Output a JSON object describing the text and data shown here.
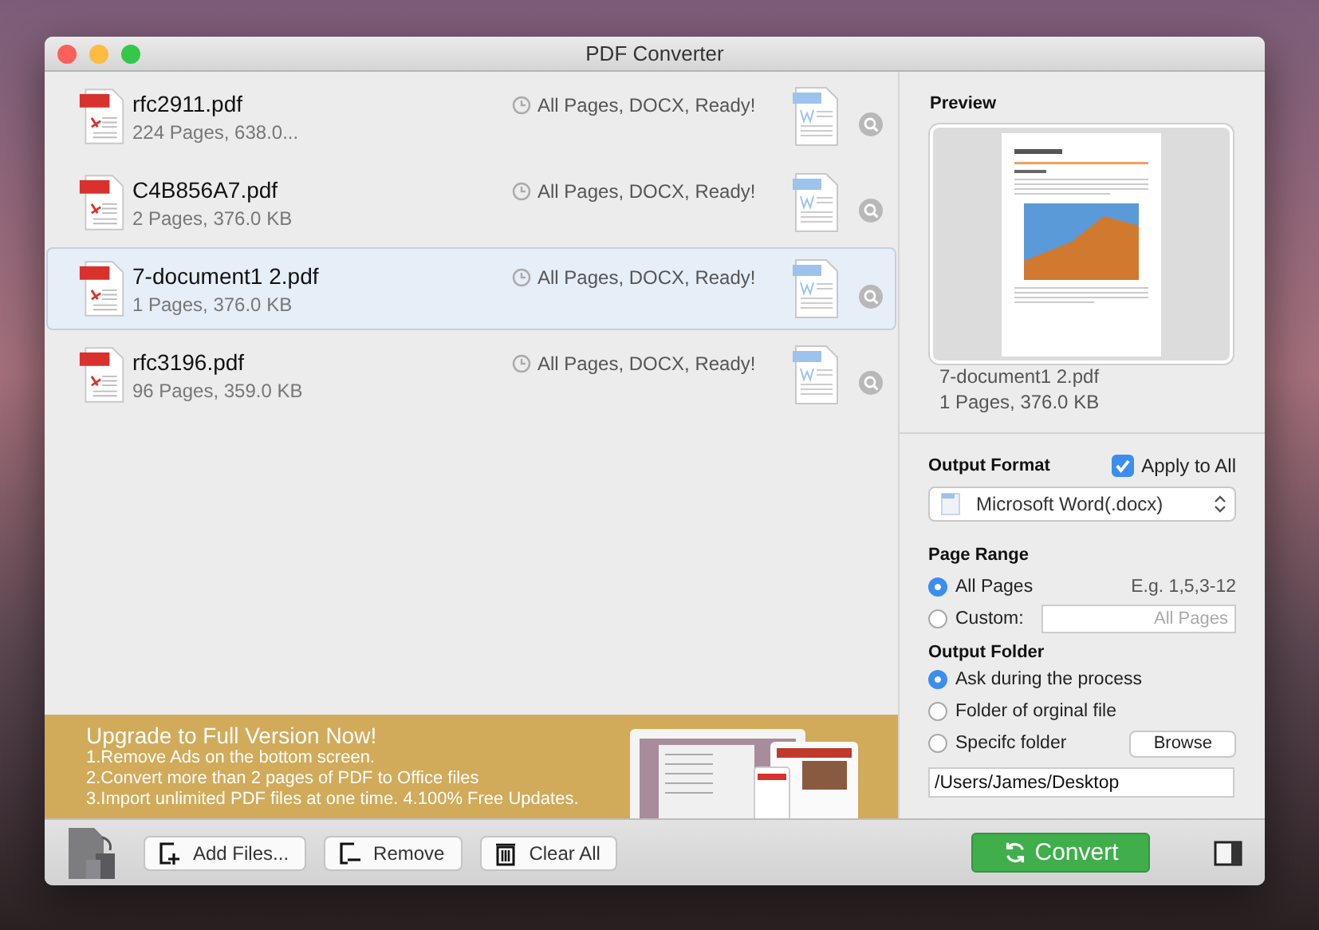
{
  "window": {
    "title": "PDF Converter"
  },
  "files": [
    {
      "name": "rfc2911.pdf",
      "info": "224 Pages, 638.0...",
      "status": "All Pages, DOCX, Ready!",
      "selected": false
    },
    {
      "name": "C4B856A7.pdf",
      "info": "2 Pages, 376.0 KB",
      "status": "All Pages, DOCX, Ready!",
      "selected": false
    },
    {
      "name": "7-document1 2.pdf",
      "info": "1 Pages, 376.0 KB",
      "status": "All Pages, DOCX, Ready!",
      "selected": true
    },
    {
      "name": "rfc3196.pdf",
      "info": "96 Pages, 359.0 KB",
      "status": "All Pages, DOCX, Ready!",
      "selected": false
    }
  ],
  "banner": {
    "title": "Upgrade to Full Version Now!",
    "lines": [
      "1.Remove Ads on the bottom screen.",
      "2.Convert more than 2 pages of PDF to Office files",
      "3.Import unlimited PDF files at one time. 4.100% Free Updates."
    ]
  },
  "toolbar": [
    {
      "label": "Add Files...",
      "kind": "add"
    },
    {
      "label": "Remove",
      "kind": "remove"
    },
    {
      "label": "Clear All",
      "kind": "clear"
    }
  ],
  "preview": {
    "title": "Preview",
    "name": "7-document1 2.pdf",
    "info": "1 Pages, 376.0 KB"
  },
  "output_format": {
    "label": "Output Format",
    "apply_to_all": {
      "label": "Apply to All",
      "checked": true
    },
    "format": "Microsoft Word(.docx)"
  },
  "page_range": {
    "label": "Page Range",
    "hint": "E.g. 1,5,3-12",
    "options": [
      {
        "label": "All Pages",
        "selected": true,
        "kind": "plain"
      },
      {
        "label": "Custom:",
        "selected": false,
        "kind": "input",
        "placeholder": "All Pages"
      }
    ]
  },
  "output_folder": {
    "label": "Output Folder",
    "options": [
      {
        "label": "Ask during the process",
        "selected": true,
        "kind": "plain"
      },
      {
        "label": "Folder of orginal file",
        "selected": false,
        "kind": "plain"
      },
      {
        "label": "Specifc folder",
        "selected": false,
        "kind": "browse",
        "button": "Browse"
      }
    ],
    "path": "/Users/James/Desktop"
  },
  "convert": {
    "label": "Convert"
  }
}
